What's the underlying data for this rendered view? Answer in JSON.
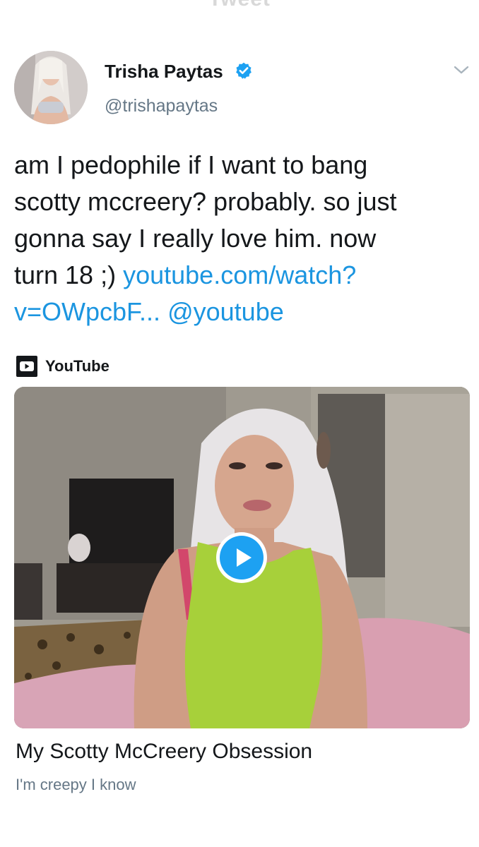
{
  "header": {
    "title": "Tweet"
  },
  "author": {
    "display_name": "Trisha Paytas",
    "handle": "@trishapaytas",
    "verified": true,
    "avatar_icon": "profile-photo"
  },
  "tweet": {
    "text_line_1": "am I pedophile if I want to bang",
    "text_line_2": "scotty mccreery? probably. so just",
    "text_line_3": "gonna say I really love him. now",
    "text_line_4_plain": "turn 18 ;) ",
    "link_url": "youtube.com/watch?",
    "link_url_cont": "v=OWpcbF...",
    "mention": "@youtube"
  },
  "card": {
    "source_icon": "youtube-icon",
    "source_name": "YouTube",
    "title": "My Scotty McCreery Obsession",
    "description": "I'm creepy I know",
    "play_icon": "play-icon"
  },
  "colors": {
    "link": "#1b95e0",
    "verified": "#1da1f2",
    "secondary_text": "#657786",
    "primary_text": "#14171a"
  }
}
